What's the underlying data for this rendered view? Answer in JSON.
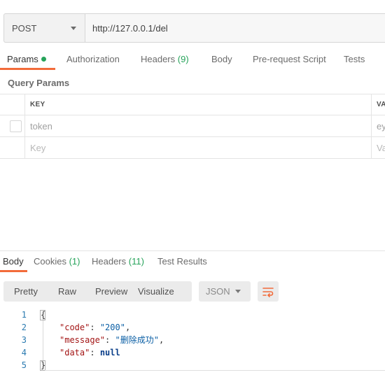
{
  "request": {
    "method": "POST",
    "url": "http://127.0.0.1/del"
  },
  "request_tabs": {
    "params": "Params",
    "authorization": "Authorization",
    "headers": "Headers",
    "headers_count": "(9)",
    "body": "Body",
    "prerequest": "Pre-request Script",
    "tests": "Tests"
  },
  "query_params": {
    "title": "Query Params",
    "col_key": "KEY",
    "col_value": "VA",
    "rows": [
      {
        "key": "token",
        "value": "ey"
      }
    ],
    "new_row": {
      "key_placeholder": "Key",
      "value_placeholder": "Va"
    }
  },
  "response_tabs": {
    "body": "Body",
    "cookies": "Cookies",
    "cookies_count": "(1)",
    "headers": "Headers",
    "headers_count": "(11)",
    "test_results": "Test Results"
  },
  "response_view": {
    "pretty": "Pretty",
    "raw": "Raw",
    "preview": "Preview",
    "visualize": "Visualize",
    "format": "JSON",
    "wrap_icon": "wrap-lines-icon"
  },
  "code": {
    "line_numbers": [
      "1",
      "2",
      "3",
      "4",
      "5"
    ],
    "open_brace": "{",
    "close_brace": "}",
    "code_key": "\"code\"",
    "code_value": "\"200\"",
    "message_key": "\"message\"",
    "message_value": "\"删除成功\"",
    "data_key": "\"data\"",
    "data_value": "null",
    "colon": ": ",
    "comma": ","
  },
  "colors": {
    "accent": "#f26b3a",
    "count_green": "#26a35a",
    "wrap_icon": "#f26b3a"
  }
}
